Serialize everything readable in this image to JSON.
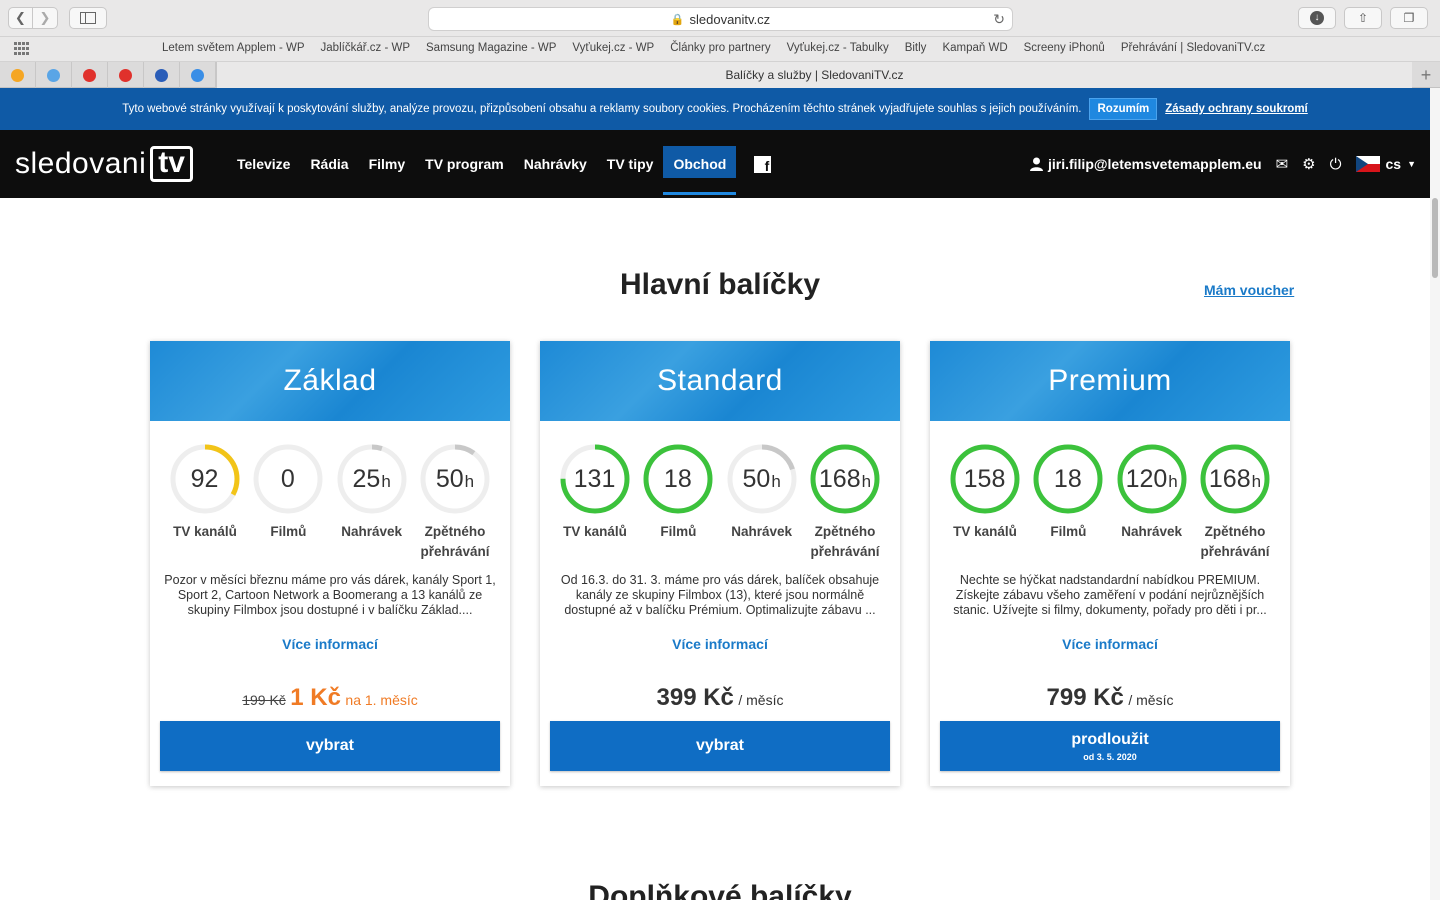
{
  "browser": {
    "url": "sledovanitv.cz",
    "tab_title": "Balíčky a služby | SledovaniTV.cz",
    "bookmarks": [
      "Letem světem Applem - WP",
      "Jablíčkář.cz - WP",
      "Samsung Magazine - WP",
      "Vyťukej.cz - WP",
      "Články pro partnery",
      "Vyťukej.cz - Tabulky",
      "Bitly",
      "Kampaň WD",
      "Screeny iPhonů",
      "Přehrávání | SledovaniTV.cz"
    ],
    "pinned_colors": [
      "#f5a623",
      "#5aa5e6",
      "#e0312c",
      "#e0312c",
      "#2a5db8",
      "#3a8ee6"
    ]
  },
  "cookie": {
    "text": "Tyto webové stránky využívají k poskytování služby, analýze provozu, přizpůsobení obsahu a reklamy soubory cookies. Procházením těchto stránek vyjadřujete souhlas s jejich používáním.",
    "agree": "Rozumím",
    "privacy": "Zásady ochrany soukromí"
  },
  "header": {
    "logo_word": "sledovani",
    "logo_tv": "tv",
    "nav": [
      "Televize",
      "Rádia",
      "Filmy",
      "TV program",
      "Nahrávky",
      "TV tipy",
      "Obchod"
    ],
    "active_index": 6,
    "user_email": "jiri.filip@letemsvetemapplem.eu",
    "lang": "cs"
  },
  "main": {
    "title": "Hlavní balíčky",
    "voucher": "Mám voucher",
    "next_section": "Doplňkové balíčky",
    "more_label": "Více informací",
    "colors": {
      "accent": "#0f6dc4",
      "green": "#3cc23c",
      "yellow": "#f2c418",
      "grey": "#c8c8c8",
      "orange": "#f07b25"
    }
  },
  "packages": [
    {
      "name": "Základ",
      "stats": [
        {
          "value": "92",
          "unit": "",
          "label": "TV kanálů",
          "fill": 0.33,
          "color": "yellow"
        },
        {
          "value": "0",
          "unit": "",
          "label": "Filmů",
          "fill": 0,
          "color": "grey"
        },
        {
          "value": "25",
          "unit": "h",
          "label": "Nahrávek",
          "fill": 0.05,
          "color": "grey"
        },
        {
          "value": "50",
          "unit": "h",
          "label": "Zpětného přehrávání",
          "fill": 0.1,
          "color": "grey"
        }
      ],
      "description": "Pozor v měsíci březnu máme pro vás dárek, kanály Sport 1, Sport 2, Cartoon Network a Boomerang a 13 kanálů ze skupiny Filmbox jsou dostupné i v balíčku Základ....",
      "price_old": "199 Kč",
      "price": "1 Kč",
      "period": "na 1. měsíc",
      "promo": true,
      "button": "vybrat",
      "button_sub": ""
    },
    {
      "name": "Standard",
      "stats": [
        {
          "value": "131",
          "unit": "",
          "label": "TV kanálů",
          "fill": 0.75,
          "color": "green"
        },
        {
          "value": "18",
          "unit": "",
          "label": "Filmů",
          "fill": 1,
          "color": "green"
        },
        {
          "value": "50",
          "unit": "h",
          "label": "Nahrávek",
          "fill": 0.2,
          "color": "grey"
        },
        {
          "value": "168",
          "unit": "h",
          "label": "Zpětného přehrávání",
          "fill": 1,
          "color": "green"
        }
      ],
      "description": "Od 16.3. do 31. 3. máme pro vás dárek, balíček obsahuje kanály ze skupiny Filmbox (13), které jsou normálně dostupné až v balíčku Prémium. Optimalizujte zábavu ...",
      "price_old": "",
      "price": "399 Kč",
      "period": "/ měsíc",
      "promo": false,
      "button": "vybrat",
      "button_sub": ""
    },
    {
      "name": "Premium",
      "stats": [
        {
          "value": "158",
          "unit": "",
          "label": "TV kanálů",
          "fill": 1,
          "color": "green"
        },
        {
          "value": "18",
          "unit": "",
          "label": "Filmů",
          "fill": 1,
          "color": "green"
        },
        {
          "value": "120",
          "unit": "h",
          "label": "Nahrávek",
          "fill": 1,
          "color": "green"
        },
        {
          "value": "168",
          "unit": "h",
          "label": "Zpětného přehrávání",
          "fill": 1,
          "color": "green"
        }
      ],
      "description": "Nechte se hýčkat nadstandardní nabídkou PREMIUM. Získejte zábavu všeho zaměření v podání nejrůznějších stanic. Užívejte si filmy, dokumenty, pořady pro děti i pr...",
      "price_old": "",
      "price": "799 Kč",
      "period": "/ měsíc",
      "promo": false,
      "button": "prodloužit",
      "button_sub": "od 3. 5. 2020"
    }
  ]
}
